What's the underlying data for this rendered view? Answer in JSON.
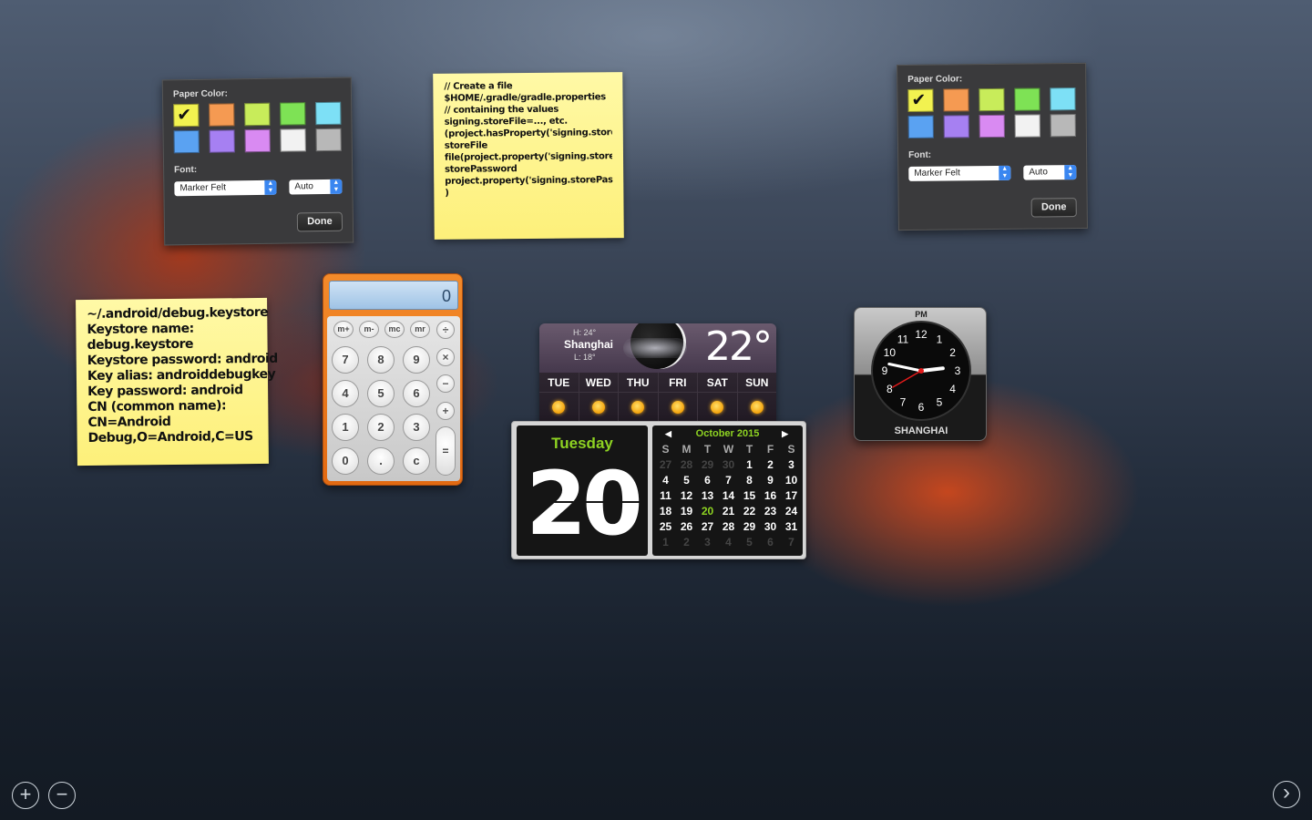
{
  "sticky_notes": [
    {
      "lines": [
        "   // Create a file",
        "$HOME/.gradle/gradle.properties",
        "// containing the values",
        "signing.storeFile=..., etc.",
        "(project.hasProperty('signing.storeFile",
        "storeFile",
        "file(project.property('signing.storeFile'",
        "storePassword",
        "project.property('signing.storePasswo",
        ")"
      ]
    },
    {
      "lines": [
        "~/.android/debug.keystore",
        "Keystore name:",
        "debug.keystore",
        "Keystore password: android",
        "Key alias: androiddebugkey",
        "Key password: android",
        "CN (common name):",
        "CN=Android",
        "Debug,O=Android,C=US"
      ]
    }
  ],
  "color_panel": {
    "paper_color_label": "Paper Color:",
    "font_label": "Font:",
    "font_value": "Marker Felt",
    "size_value": "Auto",
    "done_label": "Done",
    "swatches": [
      "#f2f250",
      "#f59a52",
      "#c8ec5a",
      "#7ee255",
      "#7de0f6",
      "#5aa2f2",
      "#a680f2",
      "#d98af2",
      "#f2f2f2",
      "#b8b8b8"
    ],
    "selected_swatch": 0
  },
  "calculator": {
    "display": "0",
    "memory_keys": [
      "m+",
      "m-",
      "mc",
      "mr"
    ],
    "op_keys": [
      "÷",
      "×",
      "−",
      "+"
    ],
    "digit_rows": [
      [
        "7",
        "8",
        "9"
      ],
      [
        "4",
        "5",
        "6"
      ],
      [
        "1",
        "2",
        "3"
      ],
      [
        "0",
        ".",
        "c"
      ]
    ],
    "equals": "="
  },
  "weather": {
    "city": "Shanghai",
    "high": "H: 24°",
    "low": "L: 18°",
    "temp": "22°",
    "days": [
      "TUE",
      "WED",
      "THU",
      "FRI",
      "SAT",
      "SUN"
    ],
    "day_icons": [
      "sunny-icon",
      "sunny-icon",
      "sunny-icon",
      "partly-cloudy-icon",
      "partly-cloudy-icon",
      "partly-cloudy-icon"
    ]
  },
  "calendar": {
    "day_name": "Tuesday",
    "day_number": "20",
    "month_title": "October 2015",
    "weekday_headers": [
      "S",
      "M",
      "T",
      "W",
      "T",
      "F",
      "S"
    ],
    "weeks": [
      [
        "27",
        "28",
        "29",
        "30",
        "1",
        "2",
        "3"
      ],
      [
        "4",
        "5",
        "6",
        "7",
        "8",
        "9",
        "10"
      ],
      [
        "11",
        "12",
        "13",
        "14",
        "15",
        "16",
        "17"
      ],
      [
        "18",
        "19",
        "20",
        "21",
        "22",
        "23",
        "24"
      ],
      [
        "25",
        "26",
        "27",
        "28",
        "29",
        "30",
        "31"
      ],
      [
        "1",
        "2",
        "3",
        "4",
        "5",
        "6",
        "7"
      ]
    ],
    "today": "20",
    "accent_color": "#8ed322"
  },
  "clock": {
    "period": "PM",
    "city": "SHANGHAI",
    "numbers": [
      "12",
      "1",
      "2",
      "3",
      "4",
      "5",
      "6",
      "7",
      "8",
      "9",
      "10",
      "11"
    ],
    "hour": 2,
    "minute": 47,
    "second": 40
  },
  "controls": {
    "add_label": "+",
    "remove_label": "−",
    "next_label": "›"
  }
}
